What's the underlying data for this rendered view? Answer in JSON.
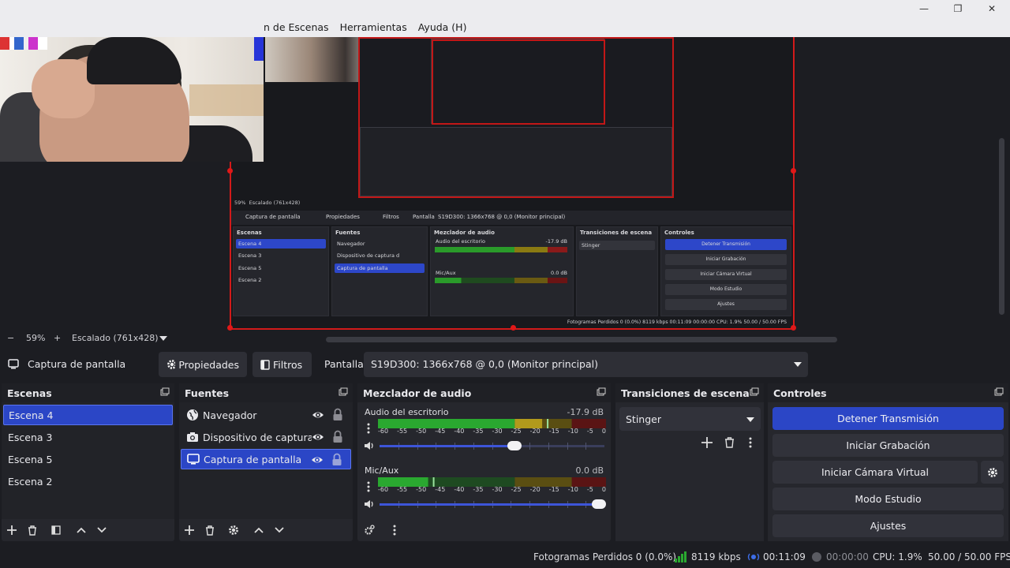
{
  "menu": {
    "items": [
      "n de Escenas",
      "Herramientas",
      "Ayuda (H)"
    ]
  },
  "window": {
    "minimize": "—",
    "maximize": "❐",
    "close": "✕"
  },
  "zoom": {
    "minus": "−",
    "level": "59%",
    "plus": "+",
    "scale_label": "Escalado (761x428)"
  },
  "source_toolbar": {
    "selected_source": "Captura de pantalla",
    "properties": "Propiedades",
    "filters": "Filtros",
    "display_label": "Pantalla",
    "display_value": "S19D300: 1366x768 @ 0,0 (Monitor principal)"
  },
  "scenes": {
    "title": "Escenas",
    "items": [
      "Escena 4",
      "Escena 3",
      "Escena 5",
      "Escena 2"
    ],
    "selected": "Escena 4"
  },
  "sources": {
    "title": "Fuentes",
    "items": [
      {
        "label": "Navegador",
        "icon": "globe-icon"
      },
      {
        "label": "Dispositivo de captura de vídeo",
        "icon": "camera-icon"
      },
      {
        "label": "Captura de pantalla",
        "icon": "monitor-icon"
      }
    ],
    "selected": "Captura de pantalla"
  },
  "mixer": {
    "title": "Mezclador de audio",
    "channels": [
      {
        "name": "Audio del escritorio",
        "db": "-17.9 dB",
        "volume": 0.6,
        "level": 0.72
      },
      {
        "name": "Mic/Aux",
        "db": "0.0 dB",
        "volume": 1.0,
        "level": 0.22
      }
    ],
    "ticks": [
      "-60",
      "-55",
      "-50",
      "-45",
      "-40",
      "-35",
      "-30",
      "-25",
      "-20",
      "-15",
      "-10",
      "-5",
      "0"
    ]
  },
  "transitions": {
    "title": "Transiciones de escena",
    "selected": "Stinger"
  },
  "controls": {
    "title": "Controles",
    "stop_stream": "Detener Transmisión",
    "start_recording": "Iniciar Grabación",
    "start_virtual_cam": "Iniciar Cámara Virtual",
    "studio_mode": "Modo Estudio",
    "settings": "Ajustes"
  },
  "status": {
    "dropped_frames": "Fotogramas Perdidos 0 (0.0%)",
    "bitrate": "8119 kbps",
    "stream_time": "00:11:09",
    "record_time": "00:00:00",
    "cpu": "CPU: 1.9%",
    "fps": "50.00 / 50.00 FPS"
  },
  "colors": {
    "accent": "#2b46c6",
    "preview_border": "#d21a1a",
    "meter_green": "#2aa830",
    "meter_yellow": "#b19a1c",
    "meter_red": "#a01c1c"
  },
  "mini_preview": {
    "scale": "59%",
    "scale_label": "Escalado (761x428)",
    "selected_source": "Captura de pantalla",
    "properties": "Propiedades",
    "filters": "Filtros",
    "display_label": "Pantalla",
    "display_value": "S19D300: 1366x768 @ 0,0 (Monitor principal)",
    "scenes_title": "Escenas",
    "scenes": [
      "Escena 4",
      "Escena 3",
      "Escena 5",
      "Escena 2"
    ],
    "sources_title": "Fuentes",
    "sources": [
      "Navegador",
      "Dispositivo de captura d",
      "Captura de pantalla"
    ],
    "mixer_title": "Mezclador de audio",
    "mixer_channels": [
      "Audio del escritorio",
      "Mic/Aux"
    ],
    "mixer_db": [
      "-17.9 dB",
      "0.0 dB"
    ],
    "transitions_title": "Transiciones de escena",
    "transition": "Stinger",
    "controls_title": "Controles",
    "controls": [
      "Detener Transmisión",
      "Iniciar Grabación",
      "Iniciar Cámara Virtual",
      "Modo Estudio",
      "Ajustes"
    ],
    "status": "Fotogramas Perdidos 0 (0.0%)   8119 kbps   00:11:09   00:00:00   CPU: 1.9%   50.00 / 50.00 FPS"
  }
}
